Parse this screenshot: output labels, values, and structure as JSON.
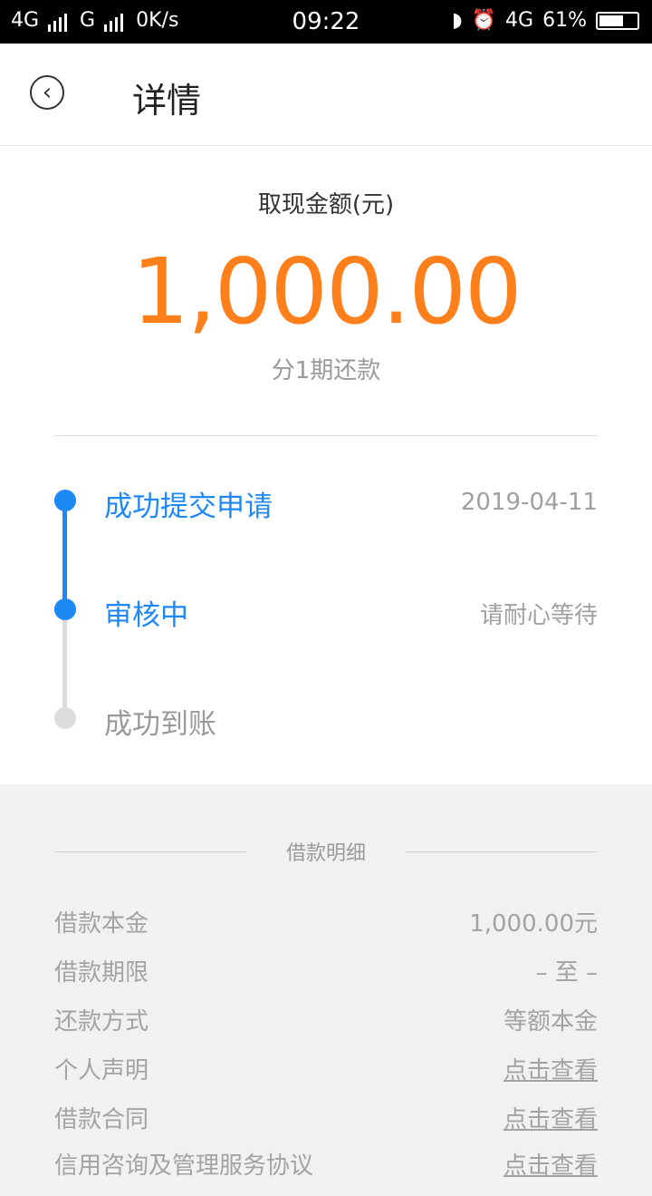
{
  "status_bar": {
    "network1": "4G",
    "network2": "G",
    "speed": "0K/s",
    "time": "09:22",
    "network3": "4G",
    "battery": "61%",
    "icons": [
      "moon-icon",
      "alarm-icon",
      "battery-icon"
    ]
  },
  "nav": {
    "title": "详情",
    "back_icon": "back-arrow-icon"
  },
  "summary": {
    "amount_label": "取现金额(元)",
    "amount": "1,000.00",
    "installment": "分1期还款",
    "colors": {
      "amount": "#ff7f1a",
      "active": "#1e88f5"
    }
  },
  "timeline": {
    "steps": [
      {
        "label": "成功提交申请",
        "right": "2019-04-11",
        "state": "active"
      },
      {
        "label": "审核中",
        "right": "请耐心等待",
        "state": "active"
      },
      {
        "label": "成功到账",
        "right": "",
        "state": "pending"
      }
    ]
  },
  "details": {
    "title": "借款明细",
    "rows": [
      {
        "key": "借款本金",
        "value": "1,000.00元"
      },
      {
        "key": "借款期限",
        "value": "– 至 –"
      },
      {
        "key": "还款方式",
        "value": "等额本金"
      },
      {
        "key": "个人声明",
        "value": "点击查看"
      },
      {
        "key": "借款合同",
        "value": "点击查看"
      },
      {
        "key": "信用咨询及管理服务协议",
        "value": "点击查看"
      }
    ]
  }
}
